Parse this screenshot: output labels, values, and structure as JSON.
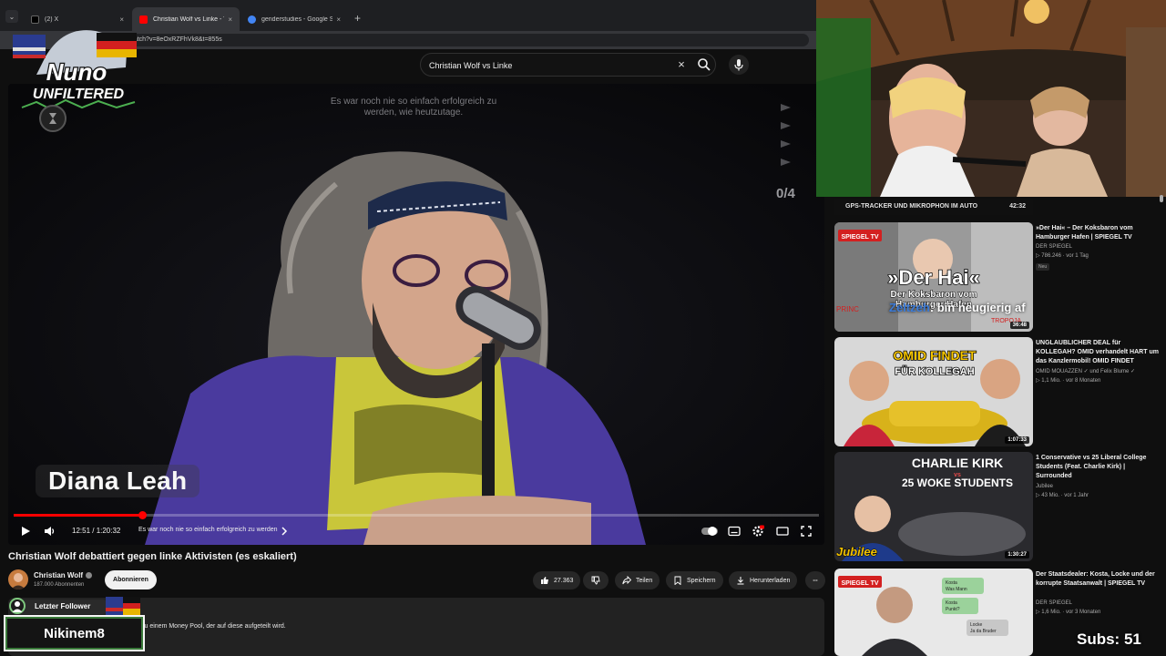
{
  "browser": {
    "tabs": [
      {
        "title": "(2) X",
        "favicon_color": "#000000"
      },
      {
        "title": "Christian Wolf vs Linke - YouTube",
        "favicon_color": "#ff0000"
      },
      {
        "title": "genderstudies - Google Suche",
        "favicon_color": "#4285f4"
      }
    ],
    "url": "m/watch?v=8eOxRZFhVk8&t=855s",
    "new_tab": "+",
    "close_glyph": "×"
  },
  "search": {
    "value": "Christian Wolf vs Linke",
    "icon": "search-icon"
  },
  "video": {
    "overlay_caption": "Es war noch nie so einfach erfolgreich zu werden, wie heutzutage.",
    "queue_count": "0/4",
    "name_overlay": "Diana Leah",
    "time": "12:51 / 1:20:32",
    "chapter": "Es war noch nie so einfach erfolgreich zu werden",
    "progress_fraction": 0.16
  },
  "info": {
    "title": "Christian Wolf debattiert gegen linke Aktivisten (es eskaliert)",
    "channel": "Christian Wolf",
    "subscribers": "187.000 Abonnenten",
    "subscribe_label": "Abonnieren",
    "likes": "27.363",
    "share_label": "Teilen",
    "save_label": "Speichern",
    "download_label": "Herunterladen",
    "description": "zu einem Money Pool, der auf diese aufgeteilt wird."
  },
  "stream_overlay": {
    "logo_line1": "Nuno",
    "logo_line2": "UNFILTERED",
    "follower_label": "Letzter Follower",
    "follower_name": "Nikinem8",
    "subs_counter": "Subs: 51",
    "chat_user": "Zeltzeh",
    "chat_text": ": bin neugierig af"
  },
  "sidebar": {
    "top_item": {
      "title": "GPS-TRACKER UND MIKROPHON IM AUTO",
      "duration": "42:32"
    },
    "items": [
      {
        "title": "»Der Hai« – Der Koksbaron vom Hamburger Hafen | SPIEGEL TV",
        "channel": "DER SPIEGEL",
        "stats": "▷ 786.246 · vor 1 Tag",
        "badge": "Neu",
        "duration": "36:48",
        "thumb_badge": "SPIEGEL TV",
        "thumb_text1": "»Der Hai«",
        "thumb_text2": "Der Koksbaron vom",
        "thumb_text3": "Hamburger Hafen",
        "thumb_extra1": "PRINC",
        "thumb_extra2": "TROPOJA"
      },
      {
        "title": "UNGLAUBLICHER DEAL für KOLLEGAH? OMID verhandelt HART um das Kanzlermobil! OMID FINDET",
        "channel": "OMID MOUAZZEN ✓ und Felix Blume ✓",
        "stats": "▷ 1,1 Mio. · vor 8 Monaten",
        "duration": "1:07:33",
        "thumb_text1": "OMID FINDET",
        "thumb_text2": "FÜR KOLLEGAH"
      },
      {
        "title": "1 Conservative vs 25 Liberal College Students (Feat. Charlie Kirk) | Surrounded",
        "channel": "Jubilee",
        "stats": "▷ 43 Mio. · vor 1 Jahr",
        "duration": "1:30:27",
        "thumb_text1": "CHARLIE KIRK",
        "thumb_vs": "vs",
        "thumb_text2": "25 WOKE STUDENTS",
        "thumb_brand": "Jubilee"
      },
      {
        "title": "Der Staatsdealer: Kosta, Locke und der korrupte Staatsanwalt | SPIEGEL TV",
        "channel": "DER SPIEGEL",
        "stats": "▷ 1,6 Mio. · vor 3 Monaten",
        "thumb_badge": "SPIEGEL TV",
        "thumb_chat1": "Kosta",
        "thumb_chat2": "Was Mann",
        "thumb_chat3": "Kosta",
        "thumb_chat4": "Punkt?",
        "thumb_chat5": "Locke",
        "thumb_chat6": "Ja da Bruder"
      }
    ]
  },
  "colors": {
    "accent": "#ff0000",
    "background": "#0f0f0f",
    "follower_border": "#3a7a3a"
  }
}
